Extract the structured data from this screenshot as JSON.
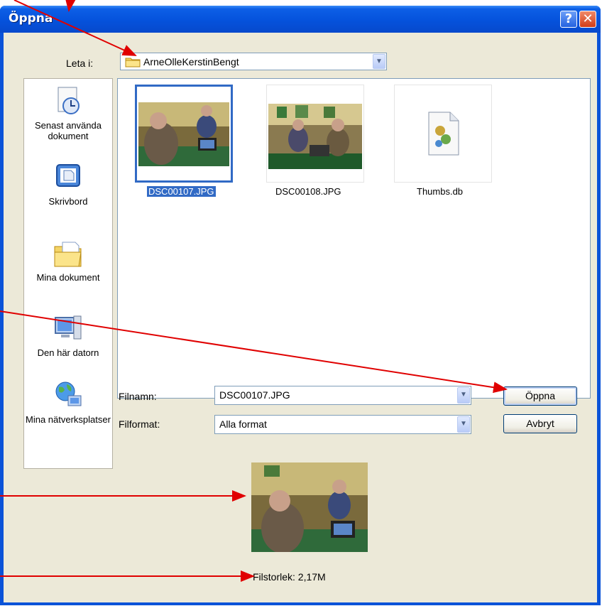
{
  "window": {
    "title": "Öppna",
    "help_label": "?",
    "close_label": "✕"
  },
  "lookin": {
    "label": "Leta i:",
    "value": "ArneOlleKerstinBengt",
    "icon": "folder-icon"
  },
  "toolbar": {
    "icons": [
      "back-icon",
      "up-folder-icon",
      "new-folder-icon",
      "view-menu-icon",
      "preview-icon"
    ]
  },
  "places": [
    {
      "label": "Senast använda dokument",
      "icon": "recent-documents-icon"
    },
    {
      "label": "Skrivbord",
      "icon": "desktop-icon"
    },
    {
      "label": "Mina dokument",
      "icon": "my-documents-icon"
    },
    {
      "label": "Den här datorn",
      "icon": "my-computer-icon"
    },
    {
      "label": "Mina nätverksplatser",
      "icon": "network-places-icon"
    }
  ],
  "files": [
    {
      "name": "DSC00107.JPG",
      "selected": true
    },
    {
      "name": "DSC00108.JPG",
      "selected": false
    },
    {
      "name": "Thumbs.db",
      "selected": false
    }
  ],
  "filename": {
    "label": "Filnamn:",
    "value": "DSC00107.JPG"
  },
  "filetype": {
    "label": "Filformat:",
    "value": "Alla format"
  },
  "buttons": {
    "open_label": "Öppna",
    "cancel_label": "Avbryt"
  },
  "preview": {
    "filesize_text": "Filstorlek: 2,17M"
  },
  "colors": {
    "title_bar": "#0552dc",
    "selection": "#316ac5",
    "annotation_arrow": "#e00000",
    "dialog_face": "#ece9d8"
  }
}
